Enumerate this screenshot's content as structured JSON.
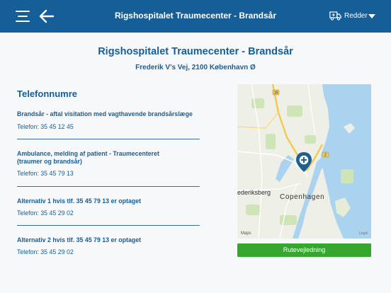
{
  "header": {
    "title": "Rigshospitalet Traumecenter - Brandsår",
    "role": "Redder"
  },
  "hospital": {
    "name": "Rigshospitalet Traumecenter - Brandsår",
    "address": "Frederik V's Vej, 2100 København Ø"
  },
  "phones": {
    "heading": "Telefonnumre",
    "entries": [
      {
        "name": "Brandsår - aftal visitation med vagthavende brandsårslæge",
        "phone": "Telefon: 35 45 12 45"
      },
      {
        "name_line1": "Ambulance, melding af patient - Traumecenteret",
        "name_line2": "(traumer og brandsår)",
        "phone": "Telefon: 35 45 79 13"
      },
      {
        "name": "Alternativ 1 hvis tlf. 35 45 79 13 er optaget",
        "phone": "Telefon: 35 45 29 02"
      },
      {
        "name": "Alternativ 2 hvis tlf. 35 45 79 13 er optaget",
        "phone": "Telefon: 35 45 29 02"
      }
    ]
  },
  "map": {
    "city_label": "Copenhagen",
    "district_label": "ederiksberg",
    "attribution": "Maps",
    "legal": "Legal",
    "road_labels": [
      "19",
      "2"
    ]
  },
  "route_button": "Rutevejledning",
  "colors": {
    "header_bg": "#155e97",
    "text_blue": "#155e97",
    "button_green": "#36a62f",
    "water": "#a9d3ef",
    "pin": "#1c5f95"
  }
}
